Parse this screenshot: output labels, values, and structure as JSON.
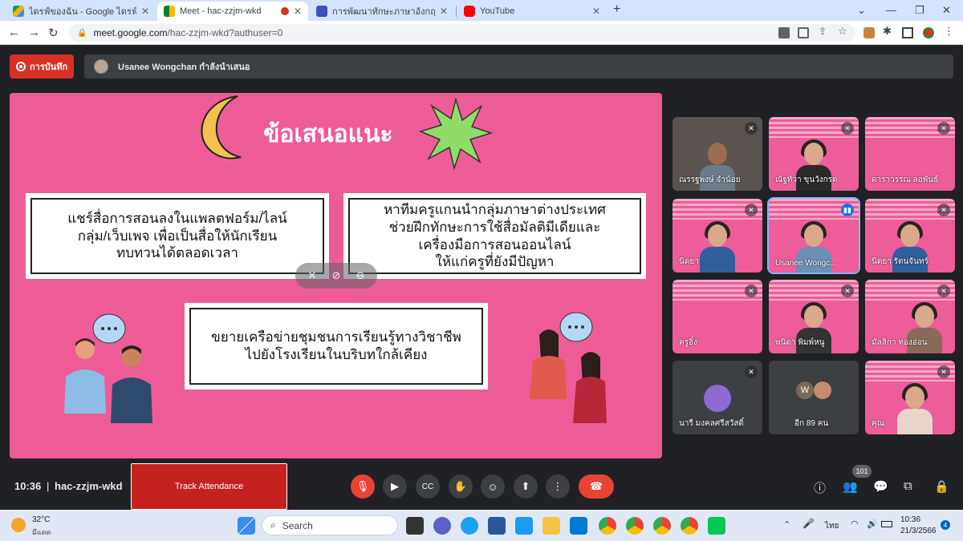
{
  "browser": {
    "tabs": [
      {
        "label": "ไดรฟ์ของฉัน - Google ไดรฟ์",
        "color": "#1a73e8"
      },
      {
        "label": "Meet - hac-zzjm-wkd",
        "color": "#00897b"
      },
      {
        "label": "การพัฒนาทักษะภาษาอังกฤษ English",
        "color": "#3f51b5"
      },
      {
        "label": "YouTube",
        "color": "#ff0000"
      }
    ],
    "new_tab": "+",
    "url_host": "meet.google.com",
    "url_path": "/hac-zzjm-wkd?authuser=0"
  },
  "meet": {
    "record_label": "การบันทึก",
    "presenter_text": "Usanee Wongchan กำลังนำเสนอ",
    "slide": {
      "title": "ข้อเสนอแนะ",
      "box1": "แชร์สื่อการสอนลงในแพลตฟอร์ม/ไลน์\nกลุ่ม/เว็บเพจ เพื่อเป็นสื่อให้นักเรียน\nทบทวนได้ตลอดเวลา",
      "box2": "หาทีมครูแกนนำกลุ่มภาษาต่างประเทศ\nช่วยฝึกทักษะการใช้สื่อมัลติมีเดียและ\nเครื่องมือการสอนออนไลน์\nให้แก่ครูที่ยังมีปัญหา",
      "box3": "ขยายเครือข่ายชุมชนการเรียนรู้ทางวิชาชีพ\nไปยังโรงเรียนในบริบทใกล้เคียง"
    },
    "participants": [
      {
        "name": "ณรรฐพงษ์ จำน้อย"
      },
      {
        "name": "ณัฐทิวา ขุนวังกรด"
      },
      {
        "name": "ดาราวรรณ ลอพันธ์"
      },
      {
        "name": "นิตยา"
      },
      {
        "name": "Usanee Wongc..."
      },
      {
        "name": "นิตยา รัตนจันทร์"
      },
      {
        "name": "ครูอิ๋ง"
      },
      {
        "name": "พนิดา พิมพ์หนู"
      },
      {
        "name": "มัลลิกา ทองอ่อน"
      },
      {
        "name": "นารี มงคลศรีสวัสดิ์"
      },
      {
        "name": "อีก 89 คน",
        "initial": "W"
      },
      {
        "name": "คุณ"
      }
    ],
    "bottom": {
      "time": "10:36",
      "sep": "|",
      "code": "hac-zzjm-wkd",
      "track_attendance": "Track Attendance",
      "people_count": "101"
    }
  },
  "taskbar": {
    "weather_temp": "32°C",
    "weather_desc": "มีแดด",
    "search": "Search",
    "lang": "ไทย",
    "clock_time": "10:36",
    "clock_date": "21/3/2566",
    "notif_count": "4"
  }
}
